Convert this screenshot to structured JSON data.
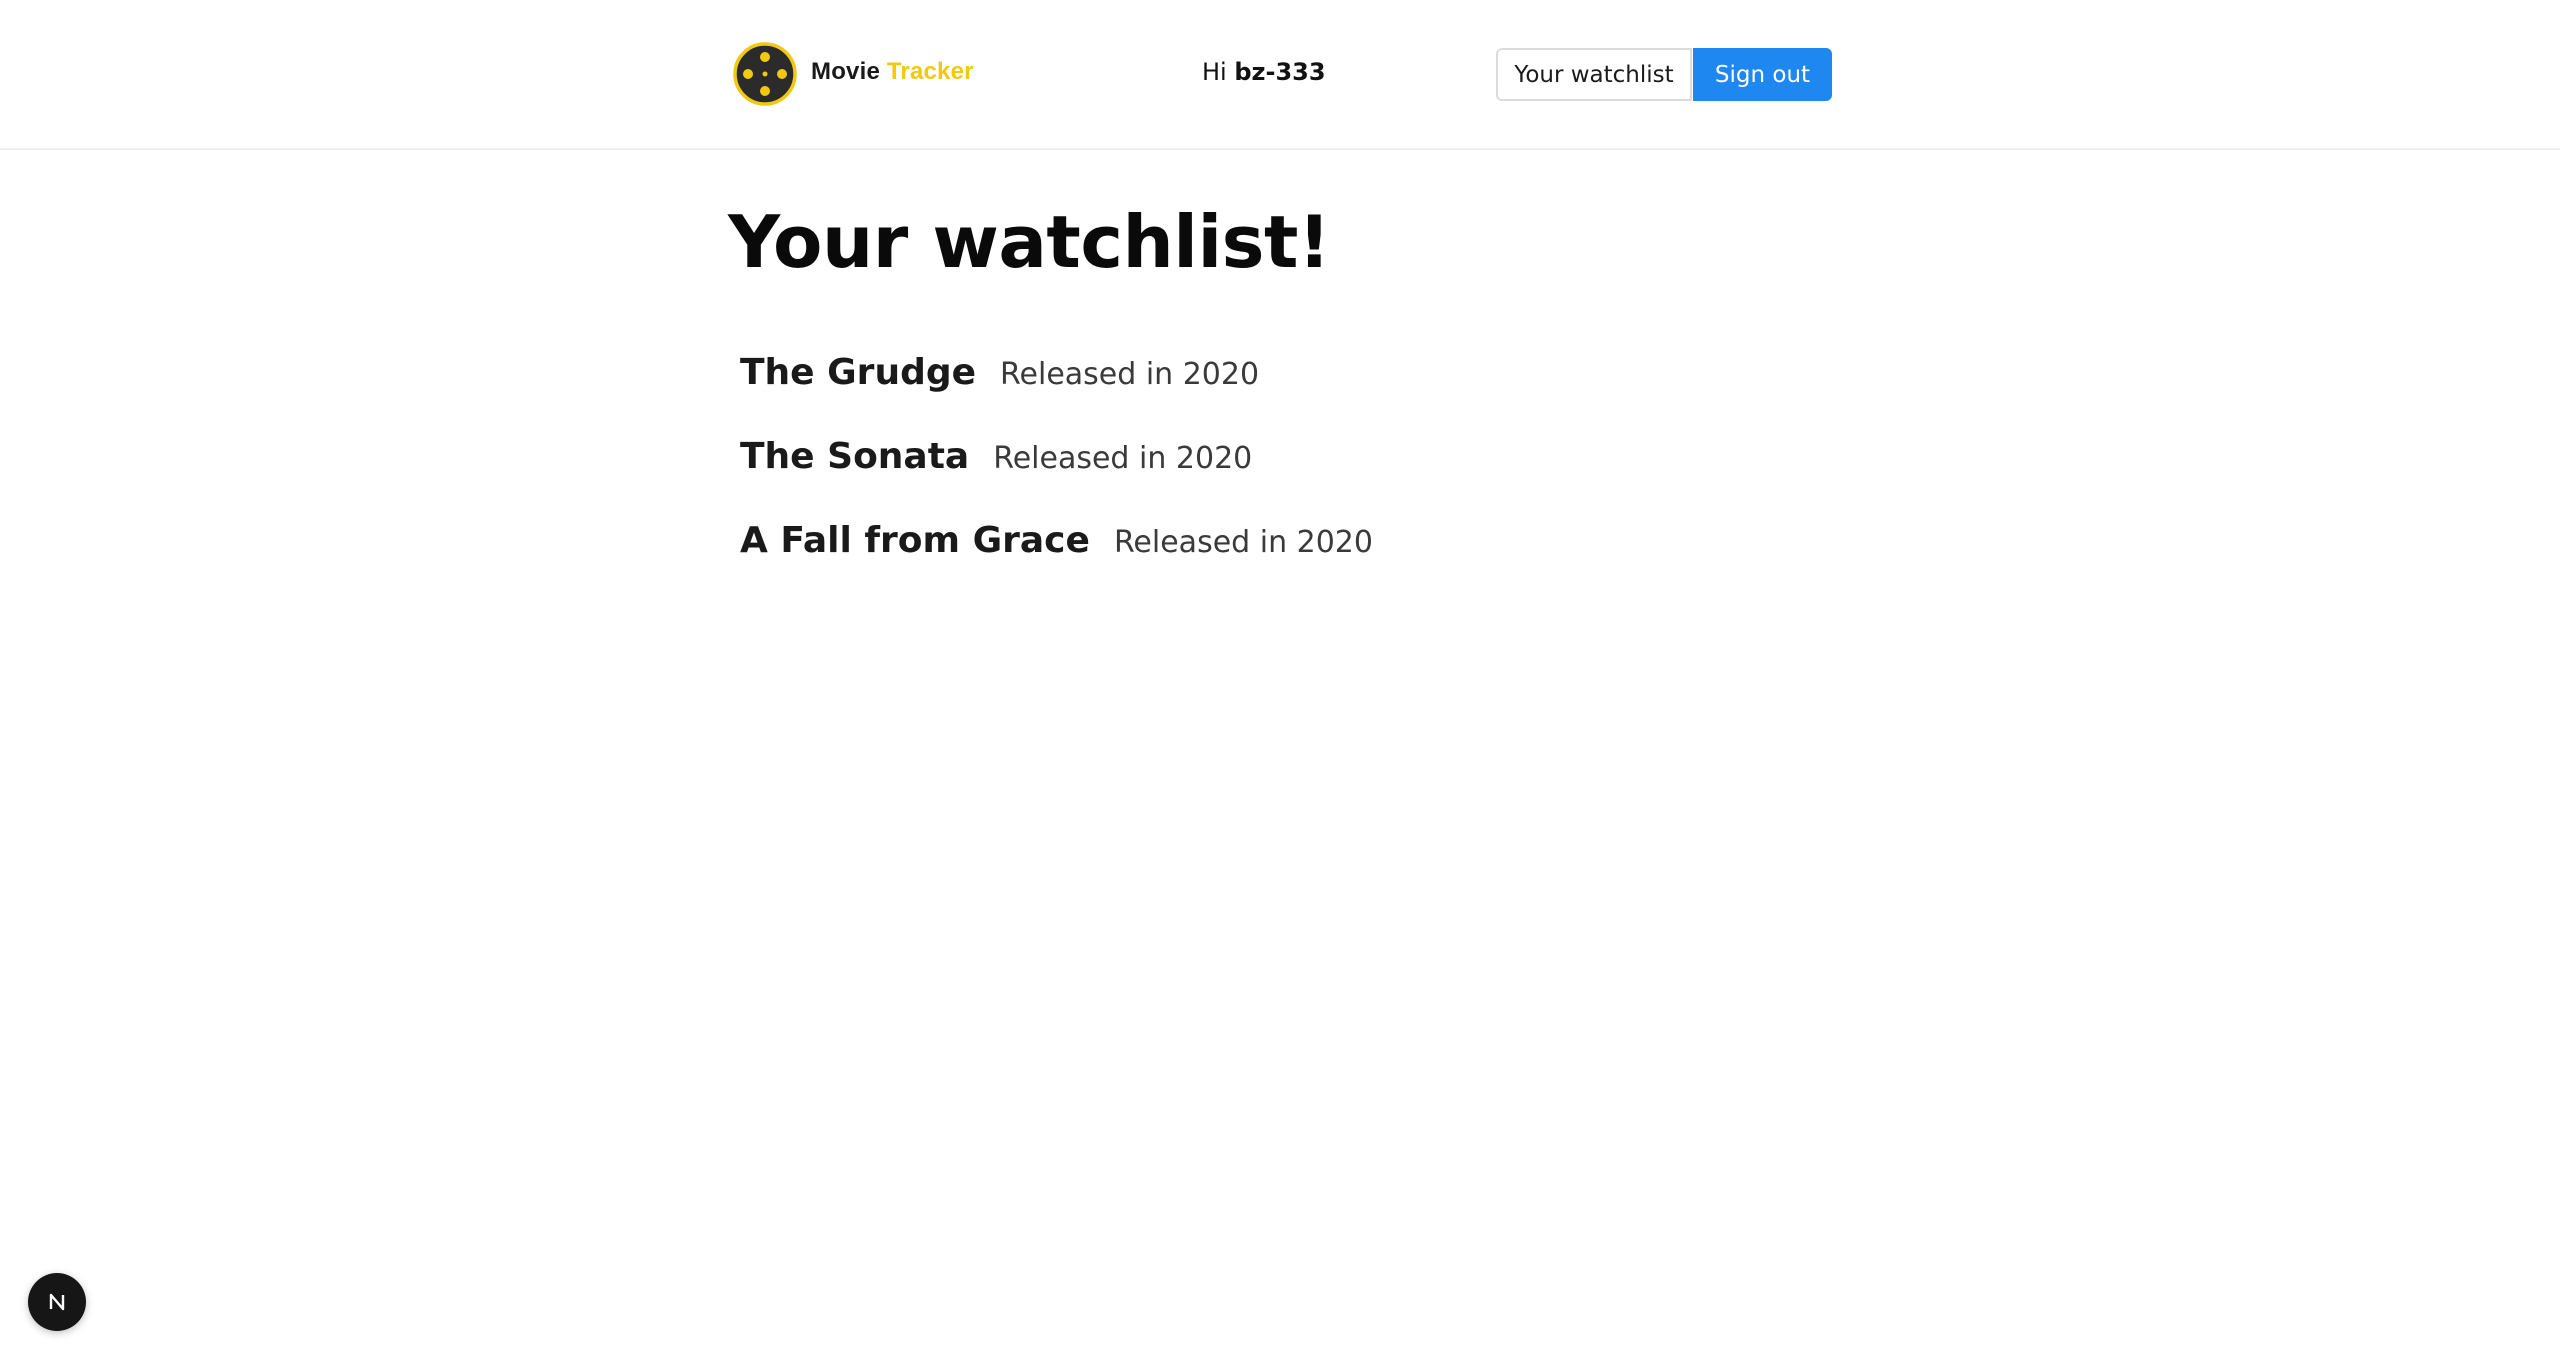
{
  "header": {
    "brand": {
      "word1": "Movie",
      "word2": "Tracker",
      "word2_color": "#f2c811"
    },
    "greeting": {
      "prefix": "Hi",
      "username": "bz-333"
    },
    "nav": {
      "watchlist_label": "Your watchlist",
      "signout_label": "Sign out",
      "primary_color": "#1e87f0"
    }
  },
  "main": {
    "title": "Your watchlist!",
    "movies": [
      {
        "title": "The Grudge",
        "meta": "Released in 2020"
      },
      {
        "title": "The Sonata",
        "meta": "Released in 2020"
      },
      {
        "title": "A Fall from Grace",
        "meta": "Released in 2020"
      }
    ]
  },
  "dev_indicator": {
    "icon": "nextjs-icon",
    "letter": "N"
  }
}
